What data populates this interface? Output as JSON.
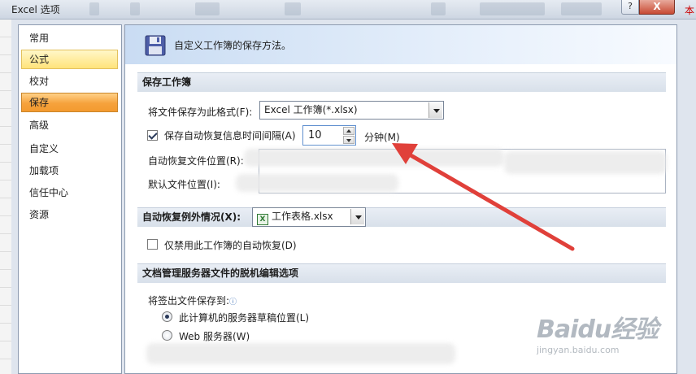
{
  "window": {
    "title": "Excel 选项",
    "help_label": "?",
    "close_label": "X",
    "edge_text": "本"
  },
  "sidebar": {
    "items": [
      {
        "label": "常用"
      },
      {
        "label": "公式",
        "state": "hover"
      },
      {
        "label": "校对"
      },
      {
        "label": "保存",
        "state": "selected"
      },
      {
        "label": "高级"
      },
      {
        "label": "自定义"
      },
      {
        "label": "加载项"
      },
      {
        "label": "信任中心"
      },
      {
        "label": "资源"
      }
    ]
  },
  "header": {
    "icon": "floppy-disk-icon",
    "text": "自定义工作簿的保存方法。"
  },
  "save_section": {
    "title": "保存工作簿",
    "format_label": "将文件保存为此格式(F):",
    "format_value": "Excel 工作簿(*.xlsx)",
    "autorecover_label": "保存自动恢复信息时间间隔(A)",
    "autorecover_checked": true,
    "interval_value": "10",
    "minutes_label": "分钟(M)",
    "autorecover_location_label": "自动恢复文件位置(R):",
    "default_location_label": "默认文件位置(I):"
  },
  "exceptions_section": {
    "title": "自动恢复例外情况(X):",
    "workbook_value": "工作表格.xlsx",
    "disable_label": "仅禁用此工作簿的自动恢复(D)",
    "disable_checked": false
  },
  "offline_section": {
    "title": "文档管理服务器文件的脱机编辑选项",
    "save_to_label": "将签出文件保存到:",
    "option_local_label": "此计算机的服务器草稿位置(L)",
    "option_web_label": "Web 服务器(W)",
    "selected": "local"
  },
  "watermark": {
    "main": "Baidu经验",
    "sub": "jingyan.baidu.com"
  },
  "colors": {
    "selected_nav": "#f6a23c",
    "hover_nav": "#ffe37a",
    "annotation_arrow": "#e0403a"
  }
}
